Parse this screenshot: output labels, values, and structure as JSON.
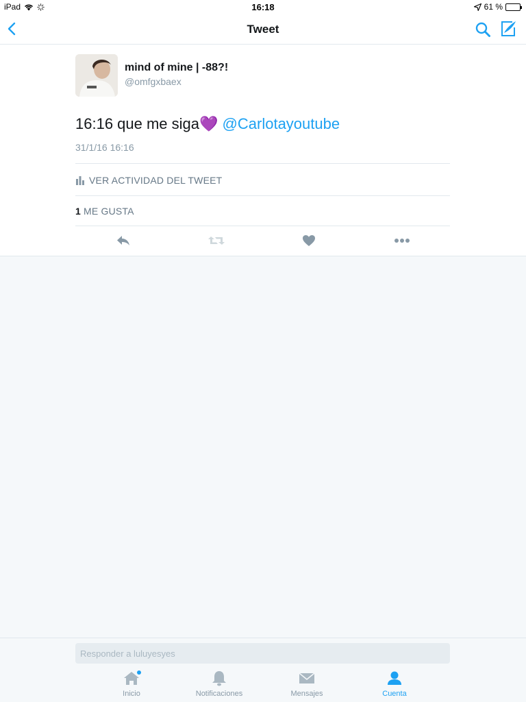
{
  "status_bar": {
    "device": "iPad",
    "time": "16:18",
    "battery": "61 %",
    "battery_level": 0.61
  },
  "navbar": {
    "title": "Tweet"
  },
  "tweet": {
    "author_name": "mind of mine | -88?!",
    "author_handle": "@omfgxbaex",
    "text": "16:16 que me siga💜",
    "mention": "@Carlotayoutube",
    "date": "31/1/16 16:16",
    "activity_label": "VER ACTIVIDAD DEL TWEET",
    "likes_count": "1",
    "likes_label": "ME GUSTA"
  },
  "reply": {
    "placeholder": "Responder a luluyesyes"
  },
  "tabs": [
    {
      "label": "Inicio",
      "icon": "home-icon"
    },
    {
      "label": "Notificaciones",
      "icon": "bell-icon"
    },
    {
      "label": "Mensajes",
      "icon": "envelope-icon"
    },
    {
      "label": "Cuenta",
      "icon": "person-icon"
    }
  ],
  "colors": {
    "accent": "#1da1f2",
    "muted": "#8899a6",
    "icon_gray": "#aab8c2"
  }
}
